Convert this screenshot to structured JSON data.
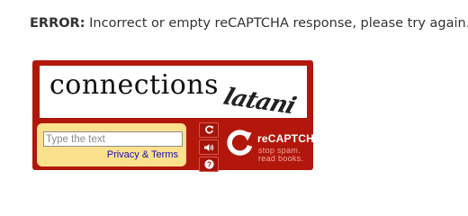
{
  "error": {
    "label": "ERROR:",
    "message": "Incorrect or empty reCAPTCHA response, please try again."
  },
  "captcha": {
    "word_1": "connections",
    "word_2": "latani",
    "input": {
      "value": "",
      "placeholder": "Type the text"
    },
    "privacy_link": "Privacy & Terms",
    "controls": [
      {
        "name": "refresh",
        "icon": "refresh-icon"
      },
      {
        "name": "audio",
        "icon": "speaker-icon"
      },
      {
        "name": "help",
        "icon": "help-icon"
      }
    ],
    "brand": {
      "name": "reCAPTCHA",
      "trademark": "™",
      "tagline_line1": "stop spam.",
      "tagline_line2": "read books."
    },
    "colors": {
      "frame": "#b3170c",
      "input_panel": "#fbe18d",
      "link": "#1a0dab"
    }
  }
}
